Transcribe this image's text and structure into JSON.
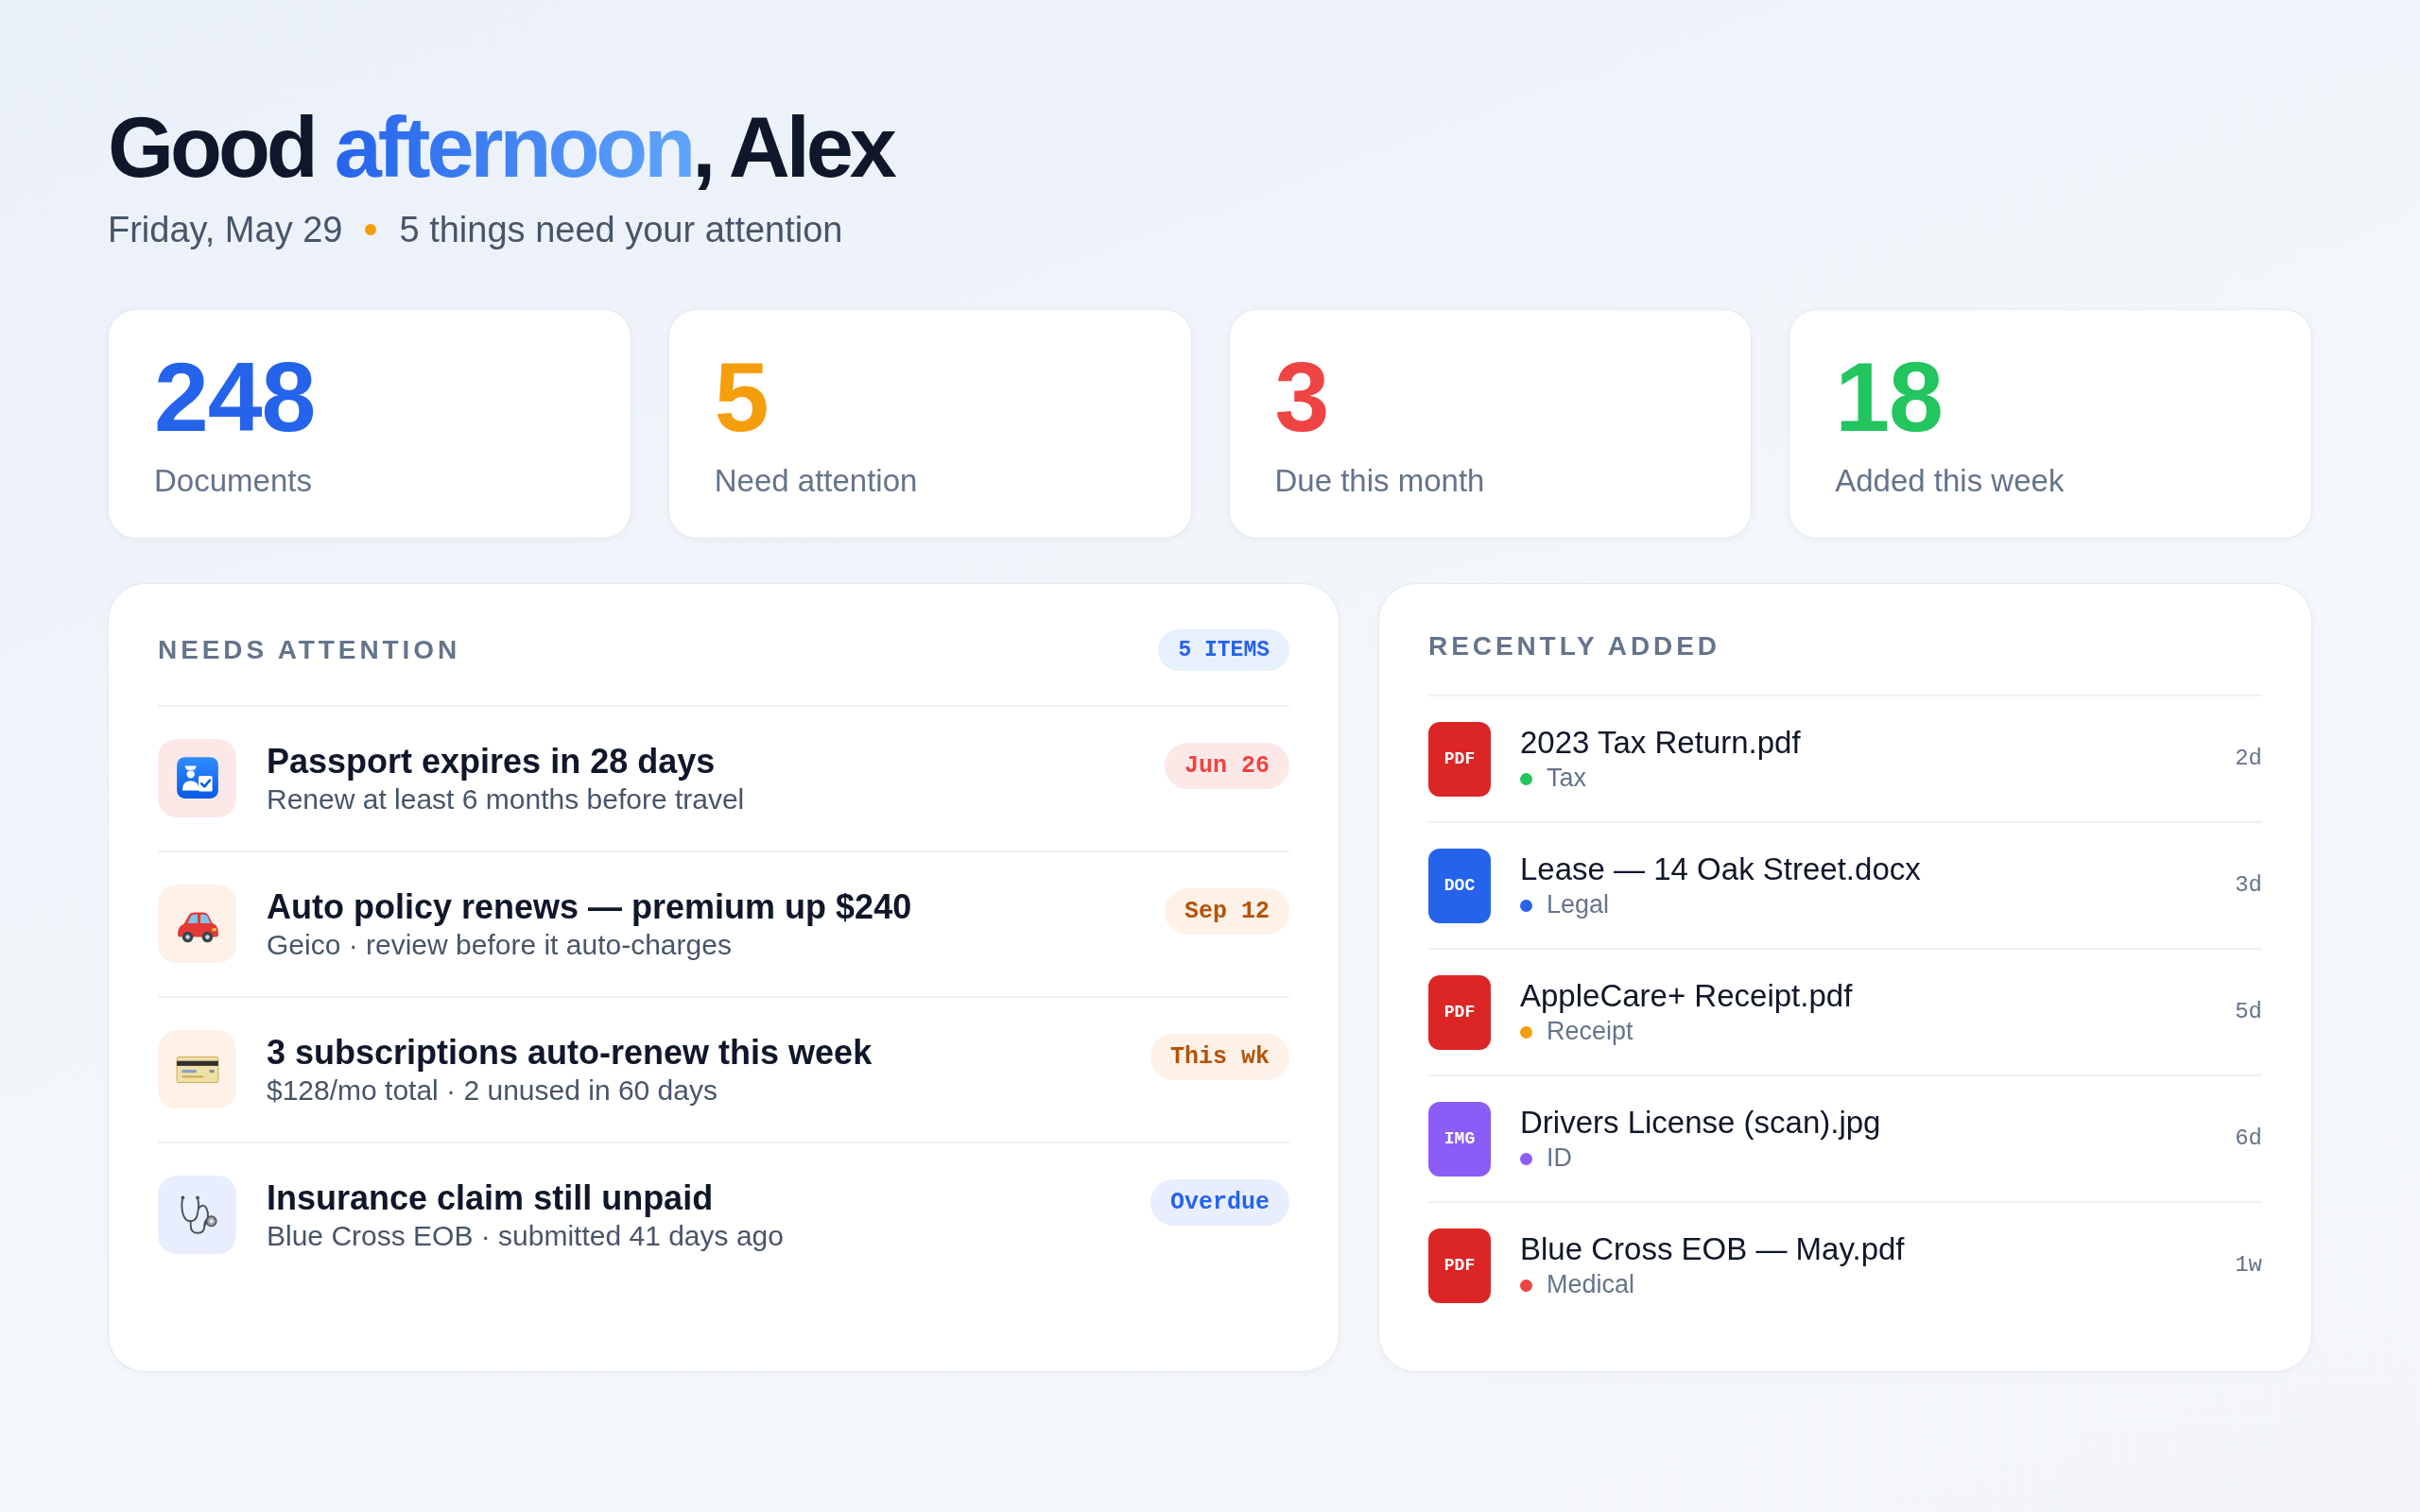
{
  "greeting": {
    "lead": "Good ",
    "accent": "afternoon",
    "tail": ", Alex"
  },
  "subtitle": {
    "date": "Friday, May 29",
    "summary": "5 things need your attention"
  },
  "stats": [
    {
      "value": "248",
      "label": "Documents",
      "color": "#2563eb"
    },
    {
      "value": "5",
      "label": "Need attention",
      "color": "#f59e0b"
    },
    {
      "value": "3",
      "label": "Due this month",
      "color": "#ef4444"
    },
    {
      "value": "18",
      "label": "Added this week",
      "color": "#22c55e"
    }
  ],
  "needs_attention": {
    "title": "NEEDS ATTENTION",
    "count": "5 ITEMS",
    "items": [
      {
        "title": "Passport expires in 28 days",
        "detail": "Renew at least 6 months before travel",
        "due": "Jun 26",
        "color": "#ef4444"
      },
      {
        "title": "Auto policy renews — premium up $240",
        "detail": "Geico · review before it auto-charges",
        "due": "Sep 12",
        "color": "#b45309"
      },
      {
        "title": "3 subscriptions auto-renew this week",
        "detail": "$128/mo total · 2 unused in 60 days",
        "due": "This wk",
        "color": "#b45309"
      },
      {
        "title": "Insurance claim still unpaid",
        "detail": "Blue Cross EOB · submitted 41 days ago",
        "due": "Overdue",
        "color": "#2563eb"
      }
    ]
  },
  "recently_added": {
    "title": "RECENTLY ADDED",
    "files": [
      {
        "name": "2023 Tax Return.pdf",
        "file_type": {
          "label": "PDF",
          "color": "#dc2626"
        },
        "tag": {
          "label": "Tax",
          "color": "#22c55e"
        },
        "age": "2d"
      },
      {
        "name": "Lease — 14 Oak Street.docx",
        "file_type": {
          "label": "DOC",
          "color": "#2563eb"
        },
        "tag": {
          "label": "Legal",
          "color": "#2563eb"
        },
        "age": "3d"
      },
      {
        "name": "AppleCare+ Receipt.pdf",
        "file_type": {
          "label": "PDF",
          "color": "#dc2626"
        },
        "tag": {
          "label": "Receipt",
          "color": "#f59e0b"
        },
        "age": "5d"
      },
      {
        "name": "Drivers License (scan).jpg",
        "file_type": {
          "label": "IMG",
          "color": "#8b5cf6"
        },
        "tag": {
          "label": "ID",
          "color": "#8b5cf6"
        },
        "age": "6d"
      },
      {
        "name": "Blue Cross EOB — May.pdf",
        "file_type": {
          "label": "PDF",
          "color": "#dc2626"
        },
        "tag": {
          "label": "Medical",
          "color": "#ef4444"
        },
        "age": "1w"
      }
    ]
  }
}
